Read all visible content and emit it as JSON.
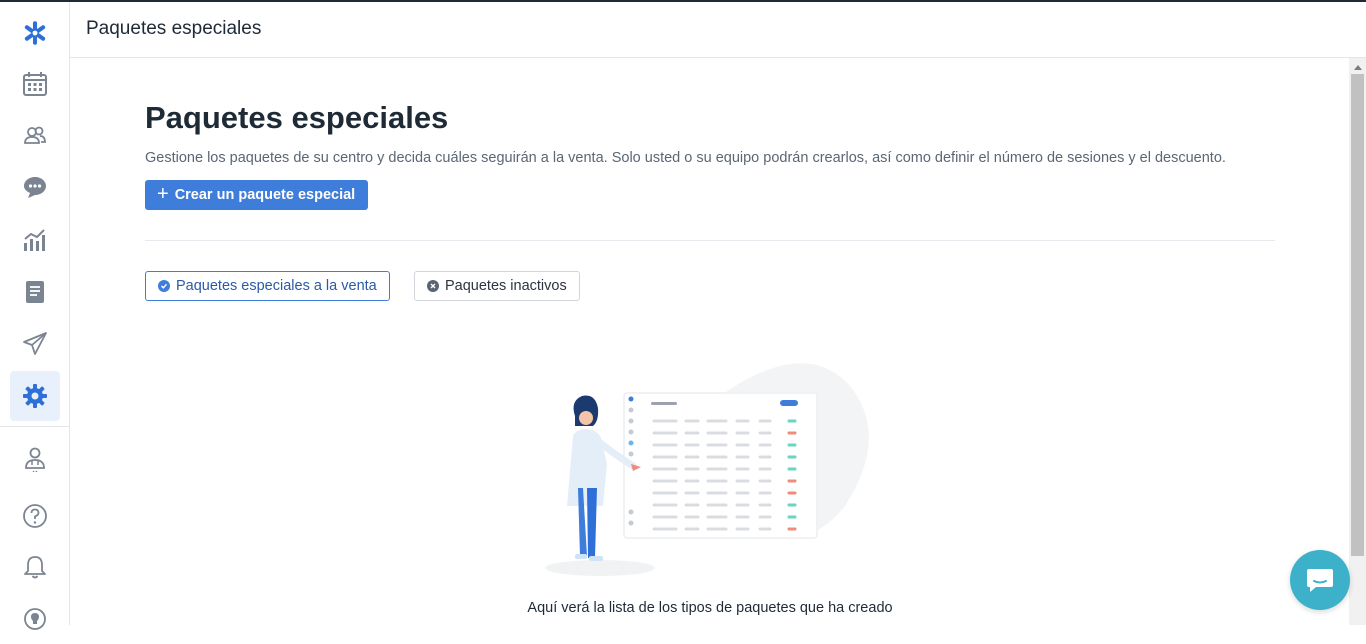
{
  "header": {
    "title": "Paquetes especiales"
  },
  "sidebar": {
    "items": [
      {
        "name": "logo",
        "icon": "logo-icon"
      },
      {
        "name": "calendar",
        "icon": "calendar-icon"
      },
      {
        "name": "patients",
        "icon": "users-icon"
      },
      {
        "name": "messages",
        "icon": "chat-icon"
      },
      {
        "name": "statistics",
        "icon": "chart-icon"
      },
      {
        "name": "records",
        "icon": "document-icon"
      },
      {
        "name": "campaigns",
        "icon": "paper-plane-icon"
      },
      {
        "name": "settings",
        "icon": "gear-icon",
        "active": true
      },
      {
        "name": "profile",
        "icon": "doctor-icon"
      },
      {
        "name": "help",
        "icon": "question-icon"
      },
      {
        "name": "notifications",
        "icon": "bell-icon"
      },
      {
        "name": "tips",
        "icon": "lightbulb-icon"
      }
    ]
  },
  "main": {
    "title": "Paquetes especiales",
    "description": "Gestione los paquetes de su centro y decida cuáles seguirán a la venta. Solo usted o su equipo podrán crearlos, así como definir el número de sesiones y el descuento.",
    "create_button": "Crear un paquete especial",
    "tabs": [
      {
        "label": "Paquetes especiales a la venta",
        "active": true
      },
      {
        "label": "Paquetes inactivos",
        "active": false
      }
    ],
    "empty_state": "Aquí verá la lista de los tipos de paquetes que ha creado"
  },
  "colors": {
    "accent": "#3f7ddb",
    "sidebar_icon": "#7b8591",
    "chat_widget": "#3cb1c9"
  }
}
